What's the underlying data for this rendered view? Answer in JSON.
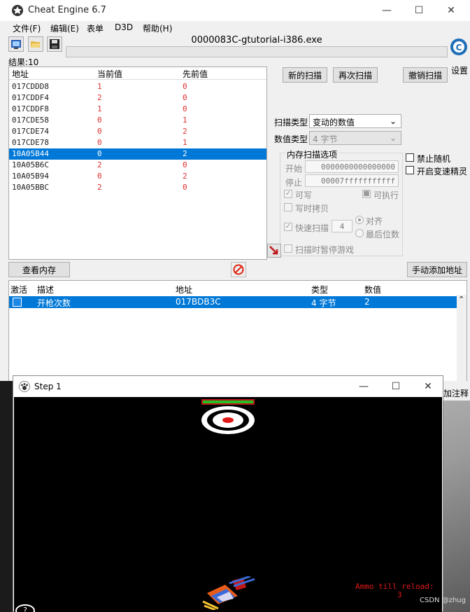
{
  "cheat_engine": {
    "title": "Cheat Engine 6.7",
    "window_controls": {
      "minimize": "—",
      "maximize": "☐",
      "close": "✕"
    },
    "menu": [
      "文件(F)",
      "编辑(E)",
      "表单",
      "D3D",
      "帮助(H)"
    ],
    "process": "0000083C-gtutorial-i386.exe",
    "results": "结果:10",
    "settings_label": "设置",
    "columns": {
      "address": "地址",
      "value": "当前值",
      "previous": "先前值"
    },
    "rows": [
      {
        "address": "017CDDD8",
        "value": "1",
        "previous": "0"
      },
      {
        "address": "017CDDF4",
        "value": "2",
        "previous": "0"
      },
      {
        "address": "017CDDF8",
        "value": "1",
        "previous": "0"
      },
      {
        "address": "017CDE58",
        "value": "0",
        "previous": "1"
      },
      {
        "address": "017CDE74",
        "value": "0",
        "previous": "2"
      },
      {
        "address": "017CDE78",
        "value": "0",
        "previous": "1"
      },
      {
        "address": "10A05B44",
        "value": "0",
        "previous": "2"
      },
      {
        "address": "10A05B6C",
        "value": "2",
        "previous": "0"
      },
      {
        "address": "10A05B94",
        "value": "0",
        "previous": "2"
      },
      {
        "address": "10A05BBC",
        "value": "2",
        "previous": "0"
      }
    ],
    "selected_row": 6,
    "buttons": {
      "new_scan": "新的扫描",
      "next_scan": "再次扫描",
      "undo_scan": "撤销扫描",
      "view_memory": "查看内存",
      "add_address": "手动添加地址"
    },
    "scan": {
      "scan_type_label": "扫描类型",
      "scan_type_value": "变动的数值",
      "value_type_label": "数值类型",
      "value_type_value": "4 字节",
      "mem_options_title": "内存扫描选项",
      "start_label": "开始",
      "start_value": "0000000000000000",
      "stop_label": "停止",
      "stop_value": "00007fffffffffff",
      "writable": "可写",
      "executable": "可执行",
      "copy_on_write": "写时拷贝",
      "fast_scan": "快速扫描",
      "fast_scan_value": "4",
      "align": "对齐",
      "last_digits": "最后位数",
      "pause_game": "扫描时暂停游戏",
      "no_random": "禁止随机",
      "speedhack": "开启变速精灵"
    },
    "cheat_table": {
      "columns": {
        "active": "激活",
        "description": "描述",
        "address": "地址",
        "type": "类型",
        "value": "数值"
      },
      "rows": [
        {
          "description": "开枪次数",
          "address": "017BDB3C",
          "type": "4 字节",
          "value": "2"
        }
      ]
    },
    "partial_right_label": "加注释"
  },
  "step_window": {
    "title": "Step 1",
    "window_controls": {
      "minimize": "—",
      "maximize": "☐",
      "close": "✕"
    },
    "ammo_label": "Ammo till reload:",
    "ammo_value": "3",
    "help_glyph": "?"
  },
  "watermark": "CSDN @zhug",
  "colors": {
    "selection": "#0078d7",
    "value_red": "#e03030",
    "health_green": "#22c022"
  },
  "icons": [
    "cheat-engine-icon",
    "open-process-icon",
    "open-file-icon",
    "save-icon",
    "cheat-engine-logo",
    "arrow-icon",
    "stop-icon",
    "paw-icon"
  ]
}
